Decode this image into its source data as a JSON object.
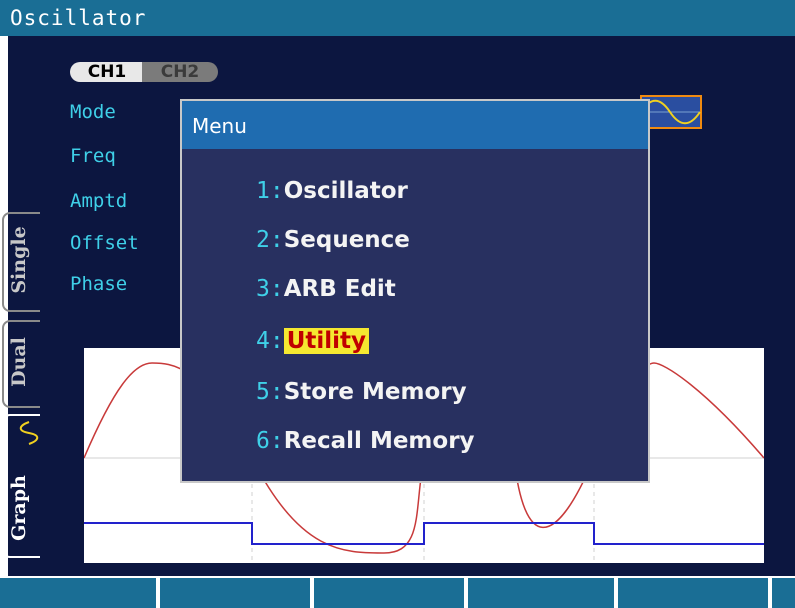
{
  "window": {
    "title": "Oscillator"
  },
  "channels": {
    "ch1": "CH1",
    "ch2": "CH2",
    "active": "CH1"
  },
  "params": [
    {
      "label": "Mode"
    },
    {
      "label": "Freq"
    },
    {
      "label": "Amptd"
    },
    {
      "label": "Offset"
    },
    {
      "label": "Phase"
    }
  ],
  "tabs": [
    {
      "label": "Single"
    },
    {
      "label": "Dual"
    },
    {
      "label": "Graph",
      "selected": true
    }
  ],
  "menu": {
    "title": "Menu",
    "items": [
      {
        "num": "1:",
        "label": "Oscillator"
      },
      {
        "num": "2:",
        "label": "Sequence"
      },
      {
        "num": "3:",
        "label": "ARB Edit"
      },
      {
        "num": "4:",
        "label": "Utility",
        "selected": true
      },
      {
        "num": "5:",
        "label": "Store Memory"
      },
      {
        "num": "6:",
        "label": "Recall Memory"
      }
    ]
  },
  "softkeys": [
    "",
    "",
    "",
    "",
    ""
  ],
  "colors": {
    "title_bg": "#1a6e95",
    "panel_bg": "#0c1640",
    "menu_bg": "#283060",
    "menu_title_bg": "#1f6cb0",
    "param_text": "#3fd0e8",
    "selected_bg": "#f5e830",
    "selected_text": "#c00000",
    "wave_red": "#c83a3a",
    "wave_blue": "#2222cc"
  },
  "icons": {
    "wave_icon": "sine-wave-icon",
    "graph_tab_icon": "sine-wave-icon"
  }
}
